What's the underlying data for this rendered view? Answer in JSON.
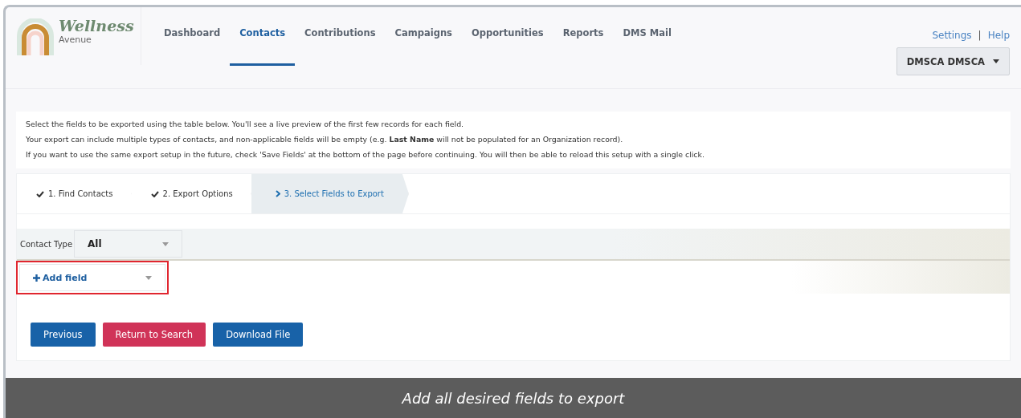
{
  "logo": {
    "title": "Wellness",
    "subtitle": "Avenue"
  },
  "nav": [
    {
      "label": "Dashboard",
      "selected": false
    },
    {
      "label": "Contacts",
      "selected": true
    },
    {
      "label": "Contributions",
      "selected": false
    },
    {
      "label": "Campaigns",
      "selected": false
    },
    {
      "label": "Opportunities",
      "selected": false
    },
    {
      "label": "Reports",
      "selected": false
    },
    {
      "label": "DMS Mail",
      "selected": false
    }
  ],
  "top_links": [
    {
      "label": "Settings"
    },
    {
      "label": "Help"
    }
  ],
  "top_links_separator": "|",
  "user_menu": {
    "label": "DMSCA DMSCA"
  },
  "intro": [
    "Select the fields to be exported using the table below. You'll see a live preview of the first few records for each field.",
    "Your export can include multiple types of contacts, and non-applicable fields will be empty (e.g. **Last Name** will not be populated for an Organization record).",
    "If you want to use the same export setup in the future, check 'Save Fields' at the bottom of the page before continuing. You will then be able to reload this setup with a single click."
  ],
  "steps": [
    {
      "label": "1. Find Contacts",
      "kind": "done",
      "selected": false
    },
    {
      "label": "2. Export Options",
      "kind": "done",
      "selected": false
    },
    {
      "label": "3. Select Fields to Export",
      "kind": "current",
      "selected": true
    }
  ],
  "contact_type": {
    "label": "Contact Type",
    "value": "All"
  },
  "add_field": {
    "label": "Add field",
    "highlighted": true
  },
  "buttons": [
    {
      "label": "Previous",
      "kind": "primary"
    },
    {
      "label": "Return to Search",
      "kind": "danger"
    },
    {
      "label": "Download File",
      "kind": "primary"
    }
  ],
  "caption": "Add all desired fields to export"
}
